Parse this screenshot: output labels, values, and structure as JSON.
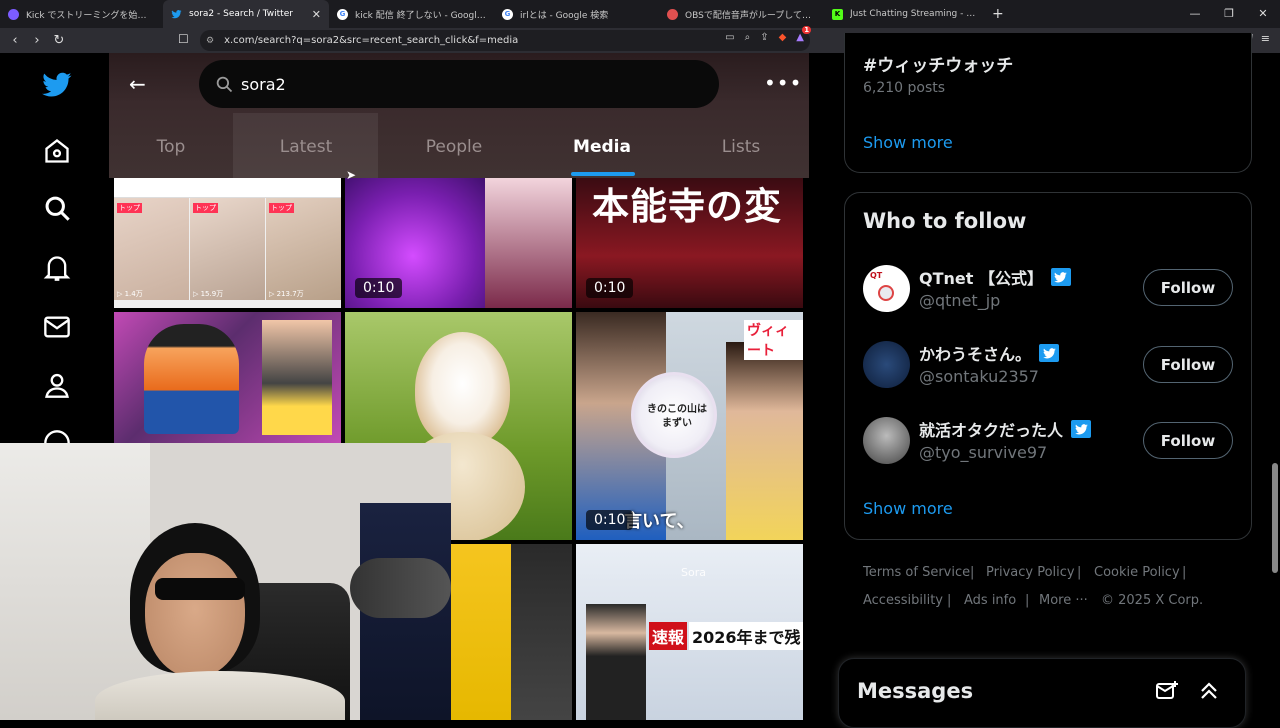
{
  "browser": {
    "tabs": [
      {
        "title": "Kick でストリーミングを始める方法: 初心者",
        "favicon_color": "#7c5cff",
        "active": false
      },
      {
        "title": "sora2 - Search / Twitter",
        "favicon_color": "#1d9bf0",
        "active": true
      },
      {
        "title": "kick 配信 終了しない - Google 検索",
        "favicon_color": "#ffffff",
        "active": false
      },
      {
        "title": "irlとは - Google 検索",
        "favicon_color": "#ffffff",
        "active": false
      },
      {
        "title": "OBSで配信音声がループしている場合の原",
        "favicon_color": "#e05050",
        "active": false
      },
      {
        "title": "Just Chatting Streaming - Live Stream",
        "favicon_color": "#53fc18",
        "active": false
      }
    ],
    "new_tab": "+",
    "url": "x.com/search?q=sora2&src=recent_search_click&f=media",
    "brave_badge": "1"
  },
  "search": {
    "query": "sora2",
    "tabs": [
      "Top",
      "Latest",
      "People",
      "Media",
      "Lists"
    ],
    "active_tab": "Media"
  },
  "media": {
    "tile1_labels": [
      "トップ",
      "トップ",
      "トップ"
    ],
    "tile1_stats": [
      "▷ 1.4万",
      "▷ 15.9万",
      "▷ 213.7万"
    ],
    "tile2_duration": "0:10",
    "tile3_text": "本能寺の変",
    "tile3_duration": "0:10",
    "tile6_badge": "ヴィィート",
    "tile6_sign": "きのこの山は\nまずい",
    "tile6_caption": "言いて、",
    "tile6_duration": "0:10",
    "tile8_watermark": "Sora",
    "tile8_headline_tag": "速報",
    "tile8_headline": "2026年まで残"
  },
  "trending": {
    "hashtag": "#ウィッチウォッチ",
    "posts": "6,210 posts",
    "show_more": "Show more"
  },
  "who_to_follow": {
    "title": "Who to follow",
    "users": [
      {
        "name": "QTnet 【公式】",
        "handle": "@qtnet_jp",
        "button": "Follow"
      },
      {
        "name": "かわうそさん。",
        "handle": "@sontaku2357",
        "button": "Follow"
      },
      {
        "name": "就活オタクだった人",
        "handle": "@tyo_survive97",
        "button": "Follow"
      }
    ],
    "show_more": "Show more"
  },
  "footer": {
    "links": [
      "Terms of Service",
      "Privacy Policy",
      "Cookie Policy",
      "Accessibility",
      "Ads info",
      "More ···"
    ],
    "copyright": "© 2025 X Corp."
  },
  "messages": {
    "title": "Messages"
  },
  "colors": {
    "accent": "#1d9bf0",
    "bg": "#000000",
    "muted": "#71767b"
  }
}
